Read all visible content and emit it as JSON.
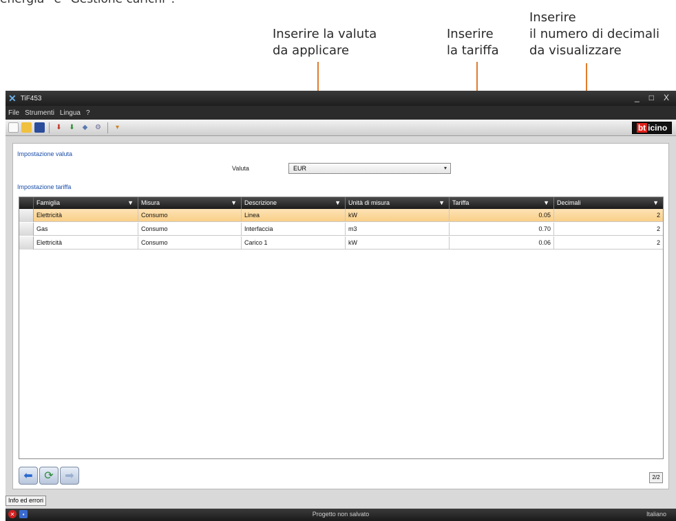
{
  "page_top_text": "energia” e “Gestione carichi”.",
  "callouts": {
    "valuta": "Inserire la valuta\nda applicare",
    "tariffa": "Inserire\nla tariffa",
    "decimali": "Inserire\nil numero di decimali\nda visualizzare"
  },
  "window": {
    "title": "TiF453",
    "controls": {
      "minimize": "_",
      "maximize": "□",
      "close": "X"
    }
  },
  "menu": [
    "File",
    "Strumenti",
    "Lingua",
    "?"
  ],
  "toolbar_icons": [
    "new-file-icon",
    "open-folder-icon",
    "save-icon",
    "send-icon",
    "receive-icon",
    "device-icon",
    "settings-icon",
    "plugin-dropdown-icon"
  ],
  "brand": {
    "part1": "bt",
    "part2": "icino"
  },
  "valuta_section": {
    "title": "Impostazione valuta",
    "label": "Valuta",
    "selected": "EUR"
  },
  "tariffa_section": {
    "title": "Impostazione tariffa",
    "columns": [
      "Famiglia",
      "Misura",
      "Descrizione",
      "Unità di misura",
      "Tariffa",
      "Decimali"
    ],
    "rows": [
      [
        "Elettricità",
        "Consumo",
        "Linea",
        "kW",
        "0.05",
        "2"
      ],
      [
        "Gas",
        "Consumo",
        "Interfaccia",
        "m3",
        "0.70",
        "2"
      ],
      [
        "Elettricità",
        "Consumo",
        "Carico 1",
        "kW",
        "0.06",
        "2"
      ]
    ],
    "selected_row": 0
  },
  "page_indicator": "2/2",
  "errors_button": "Info ed errori",
  "status": {
    "text": "Progetto non salvato",
    "language": "Italiano"
  }
}
